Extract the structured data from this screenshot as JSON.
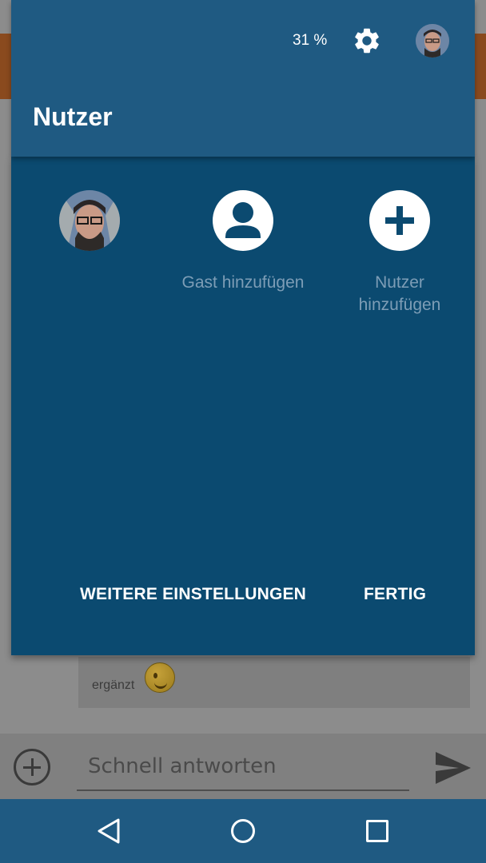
{
  "status": {
    "battery": "31 %"
  },
  "panel": {
    "title": "Nutzer",
    "users": [
      {
        "label": ""
      },
      {
        "label": "Gast hinzufügen"
      },
      {
        "label_line1": "Nutzer",
        "label_line2": "hinzufügen"
      }
    ],
    "more_settings": "WEITERE EINSTELLUNGEN",
    "done": "FERTIG"
  },
  "background": {
    "message_text": "ergänzt",
    "reply_placeholder": "Schnell antworten"
  },
  "colors": {
    "header": "#1f5a82",
    "panel": "#0b4a70",
    "label": "#7d9db6",
    "navbar": "#1f5a82"
  },
  "icons": [
    "gear-icon",
    "avatar",
    "person-icon",
    "plus-icon",
    "add-attachment-icon",
    "send-icon",
    "back-icon",
    "home-icon",
    "recents-icon",
    "wink-emoji-icon"
  ]
}
